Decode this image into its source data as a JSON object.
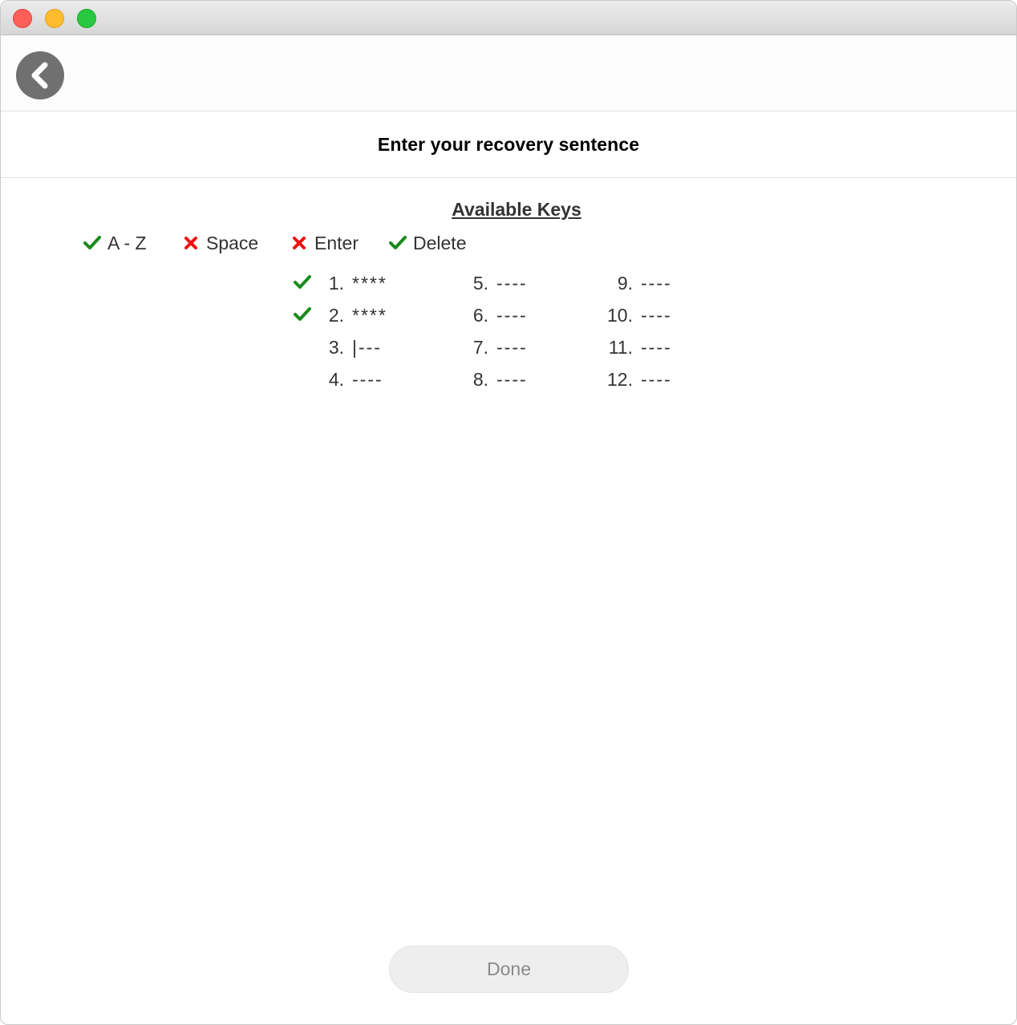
{
  "window": {
    "controls": [
      "close",
      "minimize",
      "zoom"
    ],
    "colors": {
      "close": "#fe5f57",
      "minimize": "#febc2e",
      "zoom": "#28c840"
    }
  },
  "navbar": {
    "back_icon": "chevron-left-icon"
  },
  "header": {
    "title": "Enter your recovery sentence"
  },
  "keys": {
    "heading": "Available Keys",
    "items": [
      {
        "label": "A - Z",
        "status": "available",
        "icon": "check-icon"
      },
      {
        "label": "Space",
        "status": "unavailable",
        "icon": "cross-icon"
      },
      {
        "label": "Enter",
        "status": "unavailable",
        "icon": "cross-icon"
      },
      {
        "label": "Delete",
        "status": "available",
        "icon": "check-icon"
      }
    ]
  },
  "words": [
    {
      "number": "1.",
      "value": "****",
      "complete": true
    },
    {
      "number": "2.",
      "value": "****",
      "complete": true
    },
    {
      "number": "3.",
      "value": "|---",
      "complete": false
    },
    {
      "number": "4.",
      "value": "----",
      "complete": false
    },
    {
      "number": "5.",
      "value": "----",
      "complete": false
    },
    {
      "number": "6.",
      "value": "----",
      "complete": false
    },
    {
      "number": "7.",
      "value": "----",
      "complete": false
    },
    {
      "number": "8.",
      "value": "----",
      "complete": false
    },
    {
      "number": "9.",
      "value": "----",
      "complete": false
    },
    {
      "number": "10.",
      "value": "----",
      "complete": false
    },
    {
      "number": "11.",
      "value": "----",
      "complete": false
    },
    {
      "number": "12.",
      "value": "----",
      "complete": false
    }
  ],
  "actions": {
    "done_label": "Done",
    "done_enabled": false
  },
  "colors": {
    "check": "#1a8a1a",
    "cross": "#ee1111",
    "button_bg": "#eeeeee",
    "button_text": "#8a8a8a"
  }
}
